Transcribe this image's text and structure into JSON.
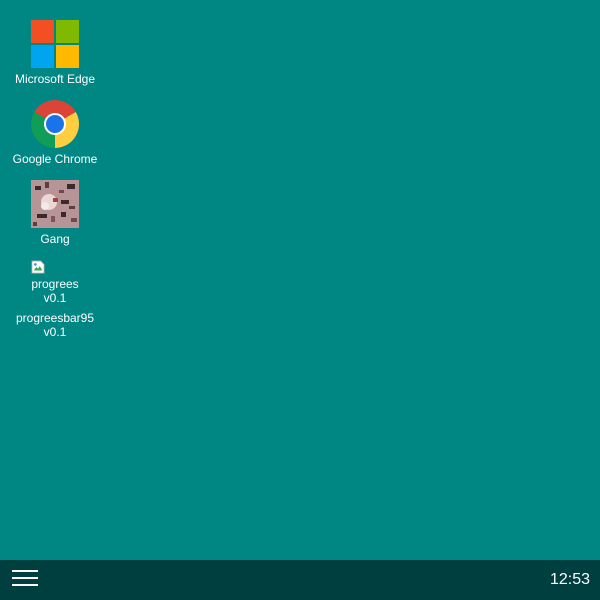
{
  "desktop": {
    "icons": [
      {
        "label": "Microsoft Edge",
        "icon": "microsoft-edge-icon"
      },
      {
        "label": "Google Chrome",
        "icon": "google-chrome-icon"
      },
      {
        "label": "Gang",
        "icon": "gang-image-icon"
      },
      {
        "label": "progreesbar95 v0.1",
        "icon": "broken-image-icon",
        "image_alt": "progrees v0.1"
      }
    ]
  },
  "taskbar": {
    "menu_icon": "hamburger-menu-icon",
    "clock": "12:53"
  },
  "colors": {
    "desktop_background": "#008784",
    "taskbar_background": "#003f3f",
    "text": "#ffffff"
  }
}
